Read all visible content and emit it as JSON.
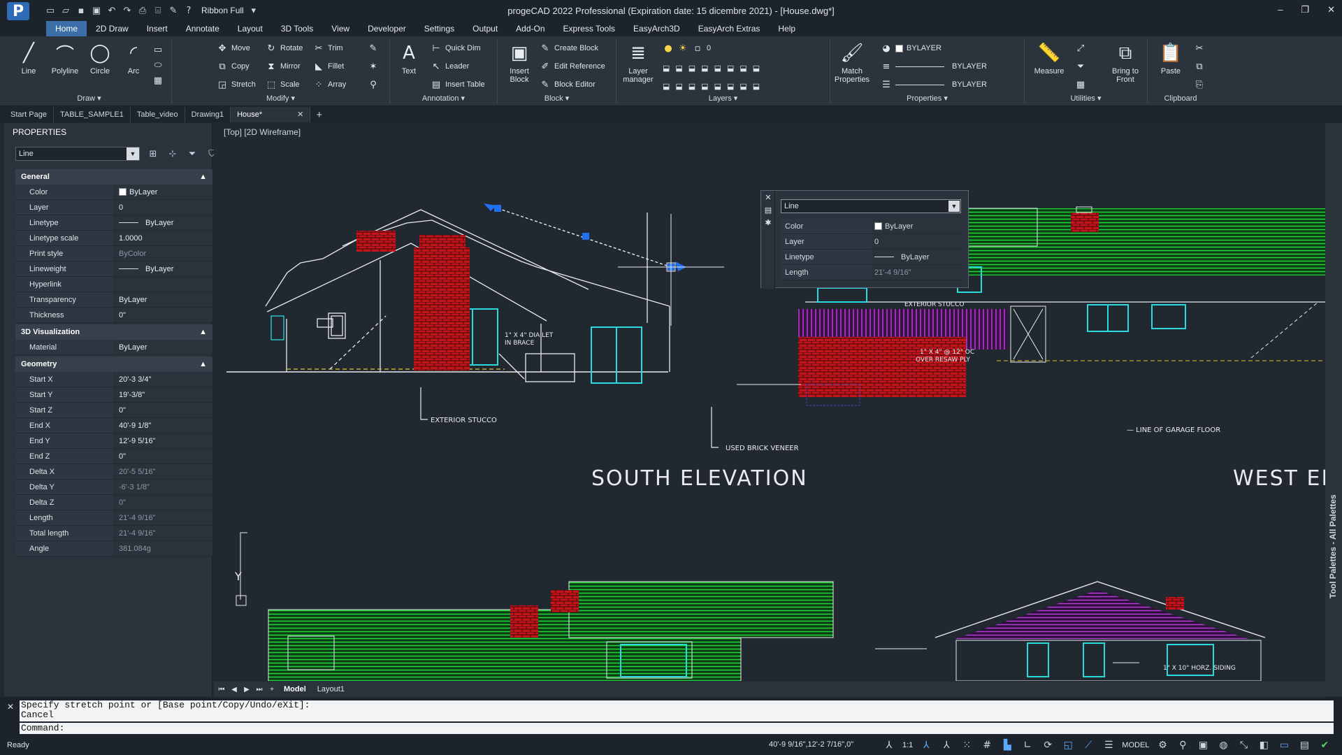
{
  "window": {
    "title": "progeCAD 2022 Professional  (Expiration date: 15 dicembre 2021) - [House.dwg*]",
    "workspace": "Ribbon Full",
    "controls": [
      "–",
      "❐",
      "✕"
    ]
  },
  "menu": [
    "Home",
    "2D Draw",
    "Insert",
    "Annotate",
    "Layout",
    "3D Tools",
    "View",
    "Developer",
    "Settings",
    "Output",
    "Add-On",
    "Express Tools",
    "EasyArch3D",
    "EasyArch Extras",
    "Help"
  ],
  "ribbon": {
    "draw": {
      "label": "Draw ▾",
      "items": [
        "Line",
        "Polyline",
        "Circle",
        "Arc"
      ]
    },
    "modify": {
      "label": "Modify ▾",
      "items": [
        "Move",
        "Rotate",
        "Trim",
        "Copy",
        "Mirror",
        "Fillet",
        "Stretch",
        "Scale",
        "Array"
      ]
    },
    "annotation": {
      "label": "Annotation ▾",
      "text": "Text",
      "items": [
        "Quick Dim",
        "Leader",
        "Insert Table"
      ]
    },
    "block": {
      "label": "Block ▾",
      "insert": "Insert Block",
      "items": [
        "Create Block",
        "Edit Reference",
        "Block Editor"
      ]
    },
    "layers": {
      "label": "Layers ▾",
      "manager": "Layer manager",
      "current": "0"
    },
    "properties": {
      "label": "Properties ▾",
      "match": "Match Properties",
      "color": "BYLAYER",
      "linetype": "BYLAYER",
      "lineweight": "BYLAYER"
    },
    "utilities": {
      "label": "Utilities ▾",
      "measure": "Measure",
      "bring": "Bring to Front"
    },
    "clipboard": {
      "label": "Clipboard",
      "paste": "Paste"
    }
  },
  "doc_tabs": [
    "Start Page",
    "TABLE_SAMPLE1",
    "Table_video",
    "Drawing1",
    "House*"
  ],
  "properties_panel": {
    "title": "PROPERTIES",
    "selection": "Line",
    "sections": [
      {
        "name": "General",
        "rows": [
          {
            "k": "Color",
            "v": "ByLayer"
          },
          {
            "k": "Layer",
            "v": "0"
          },
          {
            "k": "Linetype",
            "v": "ByLayer"
          },
          {
            "k": "Linetype scale",
            "v": "1.0000"
          },
          {
            "k": "Print style",
            "v": "ByColor"
          },
          {
            "k": "Lineweight",
            "v": "ByLayer"
          },
          {
            "k": "Hyperlink",
            "v": ""
          },
          {
            "k": "Transparency",
            "v": "ByLayer"
          },
          {
            "k": "Thickness",
            "v": "0\""
          }
        ]
      },
      {
        "name": "3D Visualization",
        "rows": [
          {
            "k": "Material",
            "v": "ByLayer"
          }
        ]
      },
      {
        "name": "Geometry",
        "rows": [
          {
            "k": "Start X",
            "v": "20'-3 3/4\""
          },
          {
            "k": "Start Y",
            "v": "19'-3/8\""
          },
          {
            "k": "Start Z",
            "v": "0\""
          },
          {
            "k": "End X",
            "v": "40'-9 1/8\""
          },
          {
            "k": "End Y",
            "v": "12'-9 5/16\""
          },
          {
            "k": "End Z",
            "v": "0\""
          },
          {
            "k": "Delta X",
            "v": "20'-5 5/16\""
          },
          {
            "k": "Delta Y",
            "v": "-6'-3 1/8\""
          },
          {
            "k": "Delta Z",
            "v": "0\""
          },
          {
            "k": "Length",
            "v": "21'-4 9/16\""
          },
          {
            "k": "Total length",
            "v": "21'-4 9/16\""
          },
          {
            "k": "Angle",
            "v": "381.084g"
          }
        ]
      }
    ]
  },
  "viewport": {
    "label": "[Top] [2D Wireframe]",
    "annotations": {
      "south": "SOUTH ELEVATION",
      "west": "WEST EL",
      "stucco1": "EXTERIOR STUCCO",
      "brick": "USED BRICK VENEER",
      "dialet1": "1\" X 4\" DIA LET",
      "dialet2": "IN BRACE",
      "stucco2": "EXTERIOR STUCCO",
      "resaw1": "1\" X 4\" @ 12\" OC",
      "resaw2": "OVER RESAW PLY",
      "garage": "— LINE OF GARAGE FLOOR",
      "siding": "1\" X 10\" HORZ. SIDING",
      "y_axis": "Y"
    }
  },
  "quick_props": {
    "selection": "Line",
    "rows": [
      {
        "k": "Color",
        "v": "ByLayer"
      },
      {
        "k": "Layer",
        "v": "0"
      },
      {
        "k": "Linetype",
        "v": "ByLayer"
      },
      {
        "k": "Length",
        "v": "21'-4 9/16\""
      }
    ]
  },
  "layout_tabs": [
    "Model",
    "Layout1"
  ],
  "command": {
    "history1": "Specify stretch point or [Base point/Copy/Undo/eXit]:",
    "history2": "Cancel",
    "prompt": "Command:"
  },
  "status": {
    "ready": "Ready",
    "coords": "40'-9 9/16\",12'-2 7/16\",0\"",
    "scale": "1:1",
    "model": "MODEL"
  },
  "tool_palettes": "Tool Palettes - All Palettes"
}
